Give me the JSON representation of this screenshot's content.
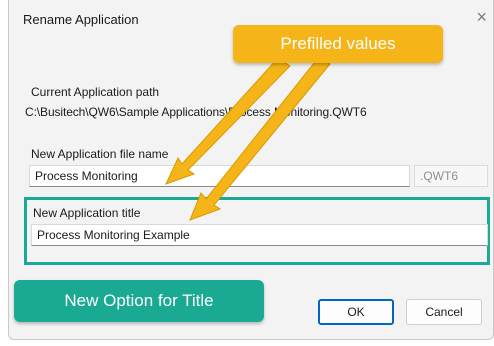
{
  "dialog": {
    "title": "Rename Application",
    "close_glyph": "×"
  },
  "current_path": {
    "label": "Current Application path",
    "value": "C:\\Busitech\\QW6\\Sample Applications\\Process Monitoring.QWT6"
  },
  "file_name": {
    "label": "New Application file name",
    "value": "Process Monitoring",
    "extension": ".QWT6"
  },
  "app_title": {
    "label": "New Application title",
    "value": "Process Monitoring Example"
  },
  "buttons": {
    "ok": "OK",
    "cancel": "Cancel"
  },
  "annotations": {
    "prefilled": "Prefilled values",
    "new_option": "New Option for Title",
    "prefilled_color": "#f5b417",
    "new_option_color": "#1aaa94"
  }
}
